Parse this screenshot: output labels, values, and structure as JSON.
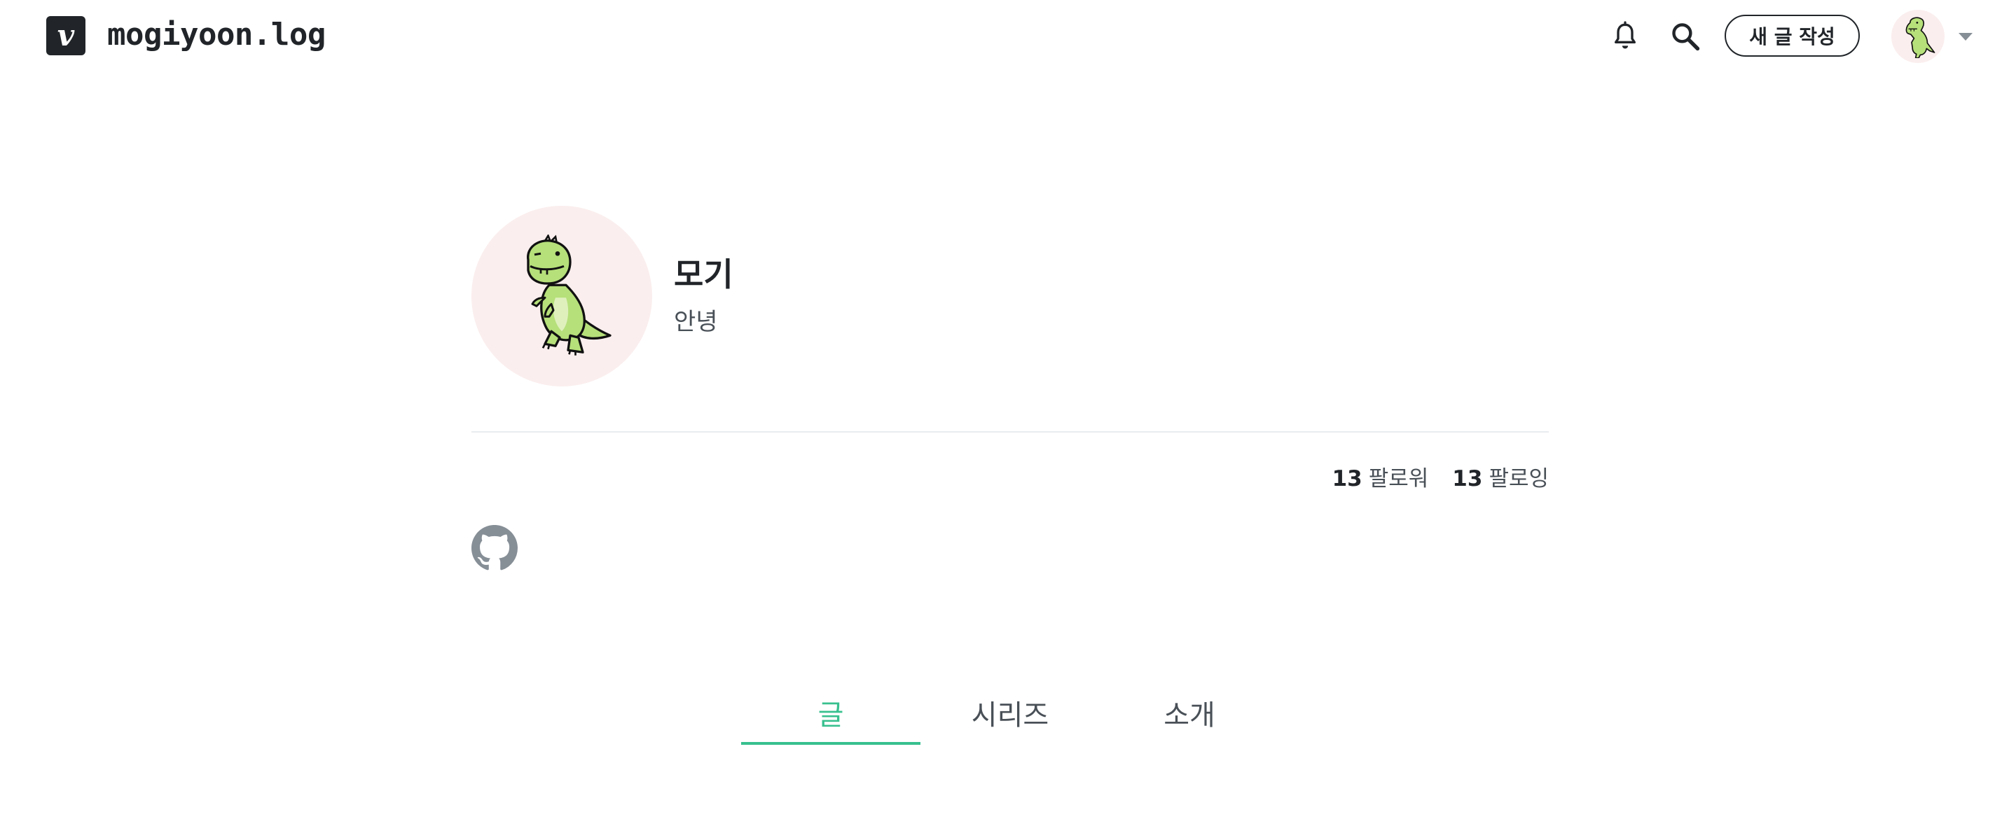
{
  "header": {
    "logo_letter": "v",
    "blog_title": "mogiyoon.log",
    "write_button_label": "새 글 작성",
    "icons": {
      "notifications": "bell-icon",
      "search": "search-icon",
      "user_menu_caret": "caret-down-icon"
    }
  },
  "profile": {
    "display_name": "모기",
    "bio": "안녕",
    "avatar": "green-dinosaur-avatar",
    "followers": {
      "count": "13",
      "label": "팔로워"
    },
    "following": {
      "count": "13",
      "label": "팔로잉"
    },
    "social_links": [
      {
        "icon": "github-icon"
      }
    ]
  },
  "tabs": {
    "items": [
      {
        "label": "글"
      },
      {
        "label": "시리즈"
      },
      {
        "label": "소개"
      }
    ],
    "active_index": 0
  },
  "colors": {
    "accent": "#38c08f",
    "text_primary": "#212529",
    "text_secondary": "#495057",
    "avatar_background": "#fbeeee",
    "icon_muted": "#868e96"
  }
}
